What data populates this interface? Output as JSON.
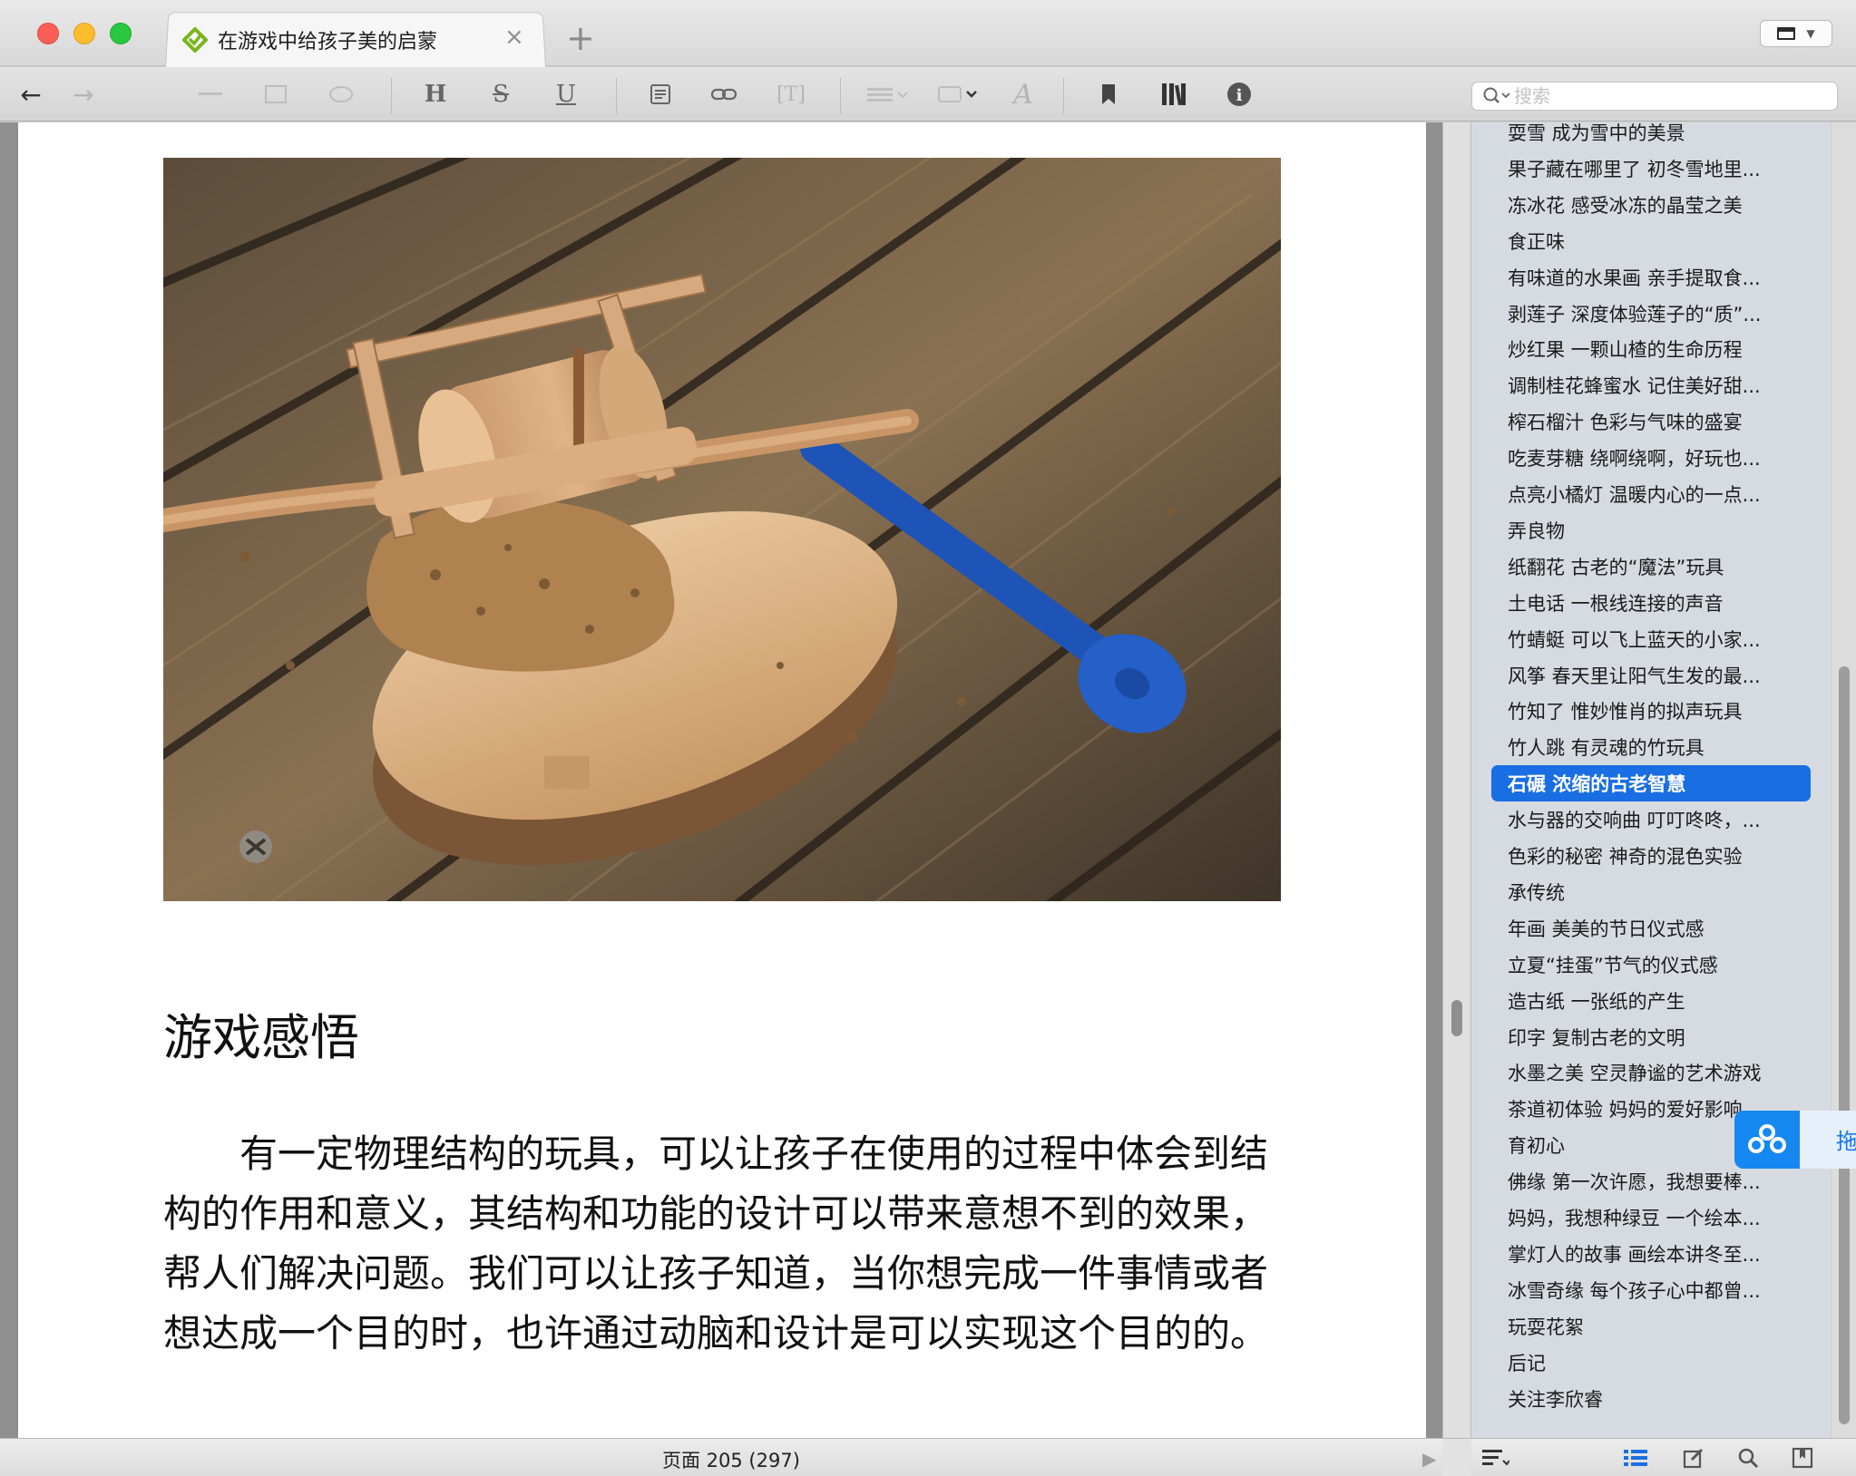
{
  "window": {
    "tab_title": "在游戏中给孩子美的启蒙",
    "tab_close": "×",
    "new_tab": "+"
  },
  "toolbar": {
    "back_icon": "←",
    "forward_icon": "→",
    "heading_label": "H",
    "strike_label": "S",
    "underline_label": "U",
    "text_box_label": "[T]",
    "font_label": "A",
    "info_label": "i"
  },
  "search": {
    "placeholder": "搜索"
  },
  "document": {
    "heading": "游戏感悟",
    "body": "有一定物理结构的玩具，可以让孩子在使用的过程中体会到结构的作用和意义，其结构和功能的设计可以带来意想不到的效果，帮人们解决问题。我们可以让孩子知道，当你想完成一件事情或者想达成一个目的时，也许通过动脑和设计是可以实现这个目的的。"
  },
  "status": {
    "page_label": "页面 205 (297)"
  },
  "toc": {
    "items": [
      "耍雪 成为雪中的美景",
      "果子藏在哪里了 初冬雪地里...",
      "冻冰花 感受冰冻的晶莹之美",
      "食正味",
      "有味道的水果画 亲手提取食...",
      "剥莲子 深度体验莲子的“质”...",
      "炒红果 一颗山楂的生命历程",
      "调制桂花蜂蜜水 记住美好甜...",
      "榨石榴汁 色彩与气味的盛宴",
      "吃麦芽糖 绕啊绕啊，好玩也...",
      "点亮小橘灯 温暖内心的一点...",
      "弄良物",
      "纸翻花 古老的“魔法”玩具",
      "土电话 一根线连接的声音",
      "竹蜻蜓 可以飞上蓝天的小家...",
      "风筝 春天里让阳气生发的最...",
      "竹知了 惟妙惟肖的拟声玩具",
      "竹人跳 有灵魂的竹玩具",
      "石碾 浓缩的古老智慧",
      "水与器的交响曲 叮叮咚咚，...",
      "色彩的秘密 神奇的混色实验",
      "承传统",
      "年画 美美的节日仪式感",
      "立夏“挂蛋”节气的仪式感",
      "造古纸 一张纸的产生",
      "印字 复制古老的文明",
      "水墨之美 空灵静谧的艺术游戏",
      "茶道初体验 妈妈的爱好影响...",
      "育初心",
      "佛缘 第一次许愿，我想要棒...",
      "妈妈，我想种绿豆 一个绘本...",
      "掌灯人的故事 画绘本讲冬至...",
      "冰雪奇缘 每个孩子心中都曾...",
      "玩耍花絮",
      "后记",
      "关注李欣睿"
    ],
    "selected_index": 18
  },
  "floating": {
    "label": "拖"
  },
  "colors": {
    "accent": "#1a6ee3",
    "tab_icon_green": "#7ab51d",
    "close_red": "#fc5f57",
    "minimize_yellow": "#fdbc2e",
    "maximize_green": "#28c840"
  }
}
